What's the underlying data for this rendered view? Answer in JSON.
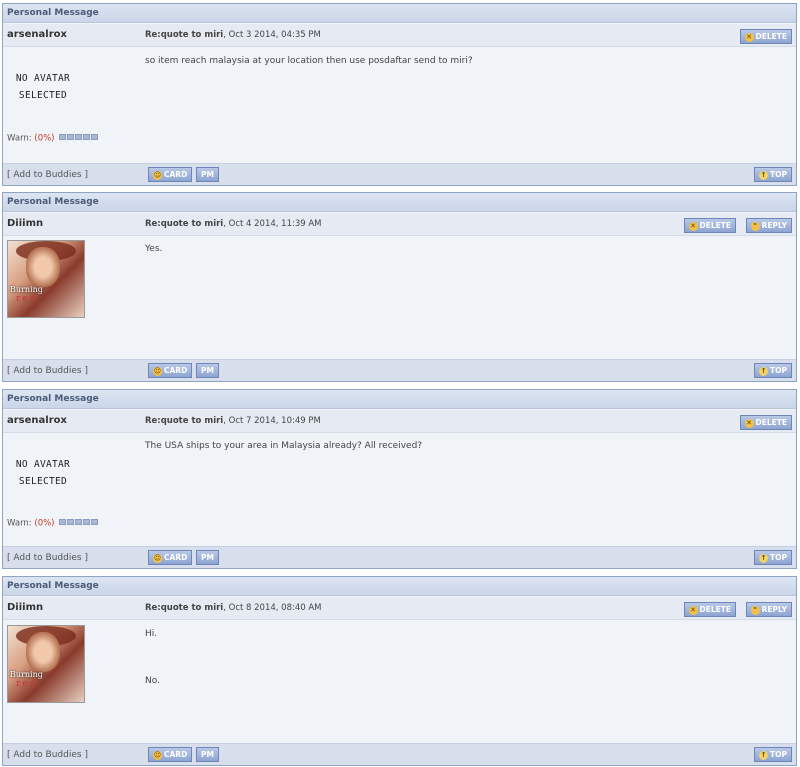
{
  "messages": [
    {
      "header": "Personal Message",
      "author": "arsenalrox",
      "subject": "Re:quote to miri",
      "date": ", Oct 3 2014, 04:35 PM",
      "lines": [
        "so item reach malaysia at your location then use posdaftar send to miri?"
      ],
      "avatar": "none",
      "noavatar_l1": "NO AVATAR",
      "noavatar_l2": "SELECTED",
      "warn_label": "Warn: ",
      "warn_value": "(0%)",
      "buddies": "[ Add to Buddies ]",
      "card": "CARD",
      "pm": "PM",
      "top": "TOP",
      "delete": "DELETE"
    },
    {
      "header": "Personal Message",
      "author": "Diiimn",
      "subject": "Re:quote to miri",
      "date": ", Oct 4 2014, 11:39 AM",
      "lines": [
        "Yes."
      ],
      "avatar": "image",
      "buddies": "[ Add to Buddies ]",
      "card": "CARD",
      "pm": "PM",
      "top": "TOP",
      "delete": "DELETE",
      "reply": "REPLY"
    },
    {
      "header": "Personal Message",
      "author": "arsenalrox",
      "subject": "Re:quote to miri",
      "date": ", Oct 7 2014, 10:49 PM",
      "lines": [
        "The USA ships to your area in Malaysia already? All received?"
      ],
      "avatar": "none",
      "noavatar_l1": "NO AVATAR",
      "noavatar_l2": "SELECTED",
      "warn_label": "Warn: ",
      "warn_value": "(0%)",
      "buddies": "[ Add to Buddies ]",
      "card": "CARD",
      "pm": "PM",
      "top": "TOP",
      "delete": "DELETE"
    },
    {
      "header": "Personal Message",
      "author": "Diiimn",
      "subject": "Re:quote to miri",
      "date": ", Oct 8 2014, 08:40 AM",
      "lines": [
        "Hi.",
        "No."
      ],
      "avatar": "image",
      "buddies": "[ Add to Buddies ]",
      "card": "CARD",
      "pm": "PM",
      "top": "TOP",
      "delete": "DELETE",
      "reply": "REPLY"
    }
  ],
  "avatar_caption_1": "Burning",
  "avatar_caption_2": "red",
  "colors": {
    "border": "#8fa3c4",
    "button": "#8ea4d1",
    "warn": "#c0392b"
  }
}
